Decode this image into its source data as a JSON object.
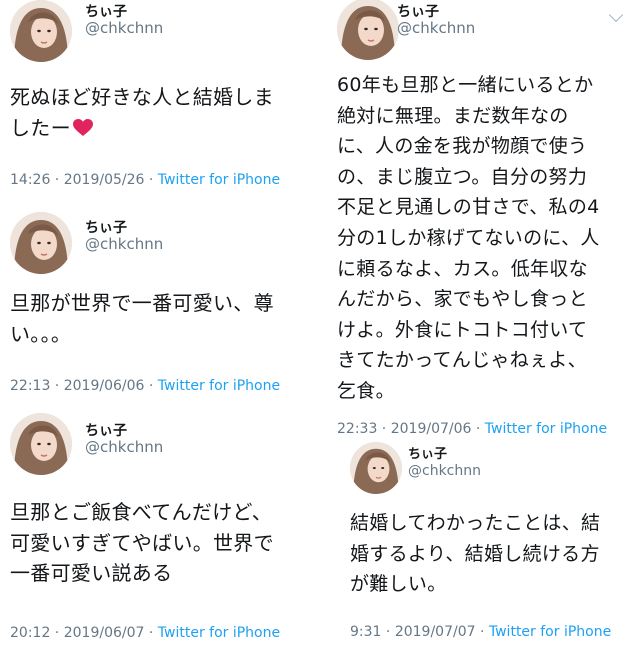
{
  "tweets": [
    {
      "display_name": "ちぃ子",
      "handle": "@chkchnn",
      "lines": [
        "死ぬほど好きな人と結婚しま",
        "したー"
      ],
      "emoji": "heart",
      "time": "14:26",
      "date": "2019/05/26",
      "source": "Twitter for iPhone"
    },
    {
      "display_name": "ちぃ子",
      "handle": "@chkchnn",
      "lines": [
        "旦那が世界で一番可愛い、尊",
        "い。。。"
      ],
      "time": "22:13",
      "date": "2019/06/06",
      "source": "Twitter for iPhone"
    },
    {
      "display_name": "ちぃ子",
      "handle": "@chkchnn",
      "lines": [
        "旦那とご飯食べてんだけど、",
        "可愛いすぎてやばい。世界で",
        "一番可愛い説ある"
      ],
      "time": "20:12",
      "date": "2019/06/07",
      "source": "Twitter for iPhone"
    },
    {
      "display_name": "ちぃ子",
      "handle": "@chkchnn",
      "lines": [
        "60年も旦那と一緒にいるとか",
        "絶対に無理。まだ数年なの",
        "に、人の金を我が物顔で使う",
        "の、まじ腹立つ。自分の努力",
        "不足と見通しの甘さで、私の4",
        "分の1しか稼げてないのに、人",
        "に頼るなよ、カス。低年収な",
        "んだから、家でもやし食っと",
        "けよ。外食にトコトコ付いて",
        "きてたかってんじゃねぇよ、",
        "乞食。"
      ],
      "time": "22:33",
      "date": "2019/07/06",
      "source": "Twitter for iPhone"
    },
    {
      "display_name": "ちぃ子",
      "handle": "@chkchnn",
      "lines": [
        "結婚してわかったことは、結",
        "婚するより、結婚し続ける方",
        "が難しい。"
      ],
      "time": "9:31",
      "date": "2019/07/07",
      "source": "Twitter for iPhone"
    }
  ],
  "colors": {
    "text": "#14171a",
    "secondary": "#657786",
    "link": "#1da1f2",
    "heart": "#e0245e"
  },
  "icons": [
    "avatar",
    "heart-emoji",
    "chevron-down-icon"
  ]
}
